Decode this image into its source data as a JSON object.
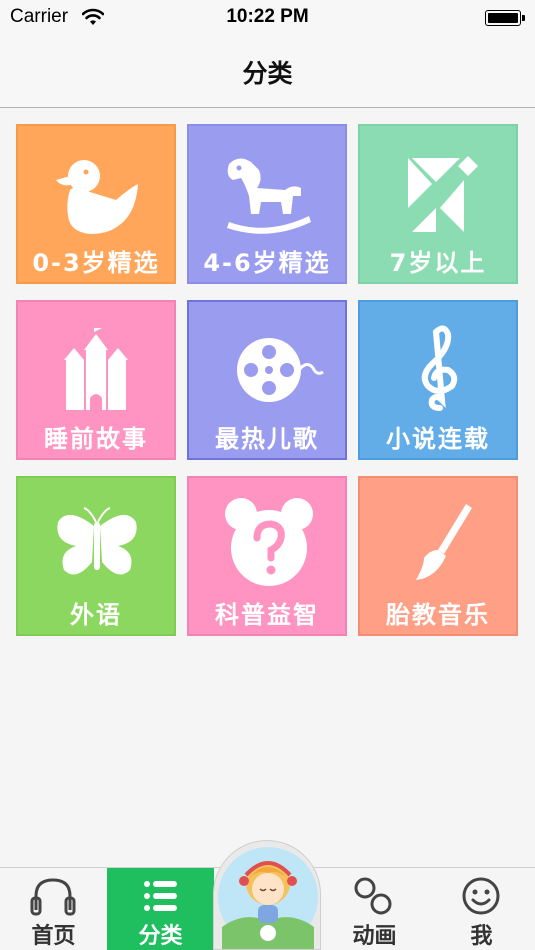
{
  "status_bar": {
    "carrier": "Carrier",
    "time": "10:22 PM"
  },
  "nav": {
    "title": "分类"
  },
  "categories": [
    {
      "label": "0-3岁精选",
      "icon": "duck-icon",
      "bg": "#ffa65a",
      "border": "#f49a4c"
    },
    {
      "label": "4-6岁精选",
      "icon": "rocking-horse-icon",
      "bg": "#9a9cf0",
      "border": "#8c8ee6"
    },
    {
      "label": "7岁以上",
      "icon": "tangram-icon",
      "bg": "#8cdcb3",
      "border": "#7fd2a8"
    },
    {
      "label": "睡前故事",
      "icon": "castle-icon",
      "bg": "#ff93c1",
      "border": "#f283b5"
    },
    {
      "label": "最热儿歌",
      "icon": "film-reel-icon",
      "bg": "#9a9cf0",
      "border": "#6f72d6"
    },
    {
      "label": "小说连载",
      "icon": "treble-clef-icon",
      "bg": "#62ade8",
      "border": "#4d9cdf"
    },
    {
      "label": "外语",
      "icon": "butterfly-icon",
      "bg": "#8cd760",
      "border": "#7fcc52"
    },
    {
      "label": "科普益智",
      "icon": "question-bear-icon",
      "bg": "#ff93c1",
      "border": "#f283b5"
    },
    {
      "label": "胎教音乐",
      "icon": "paintbrush-icon",
      "bg": "#ff9f85",
      "border": "#f58d71"
    }
  ],
  "tabs": [
    {
      "label": "首页",
      "icon": "headphones-icon",
      "active": false
    },
    {
      "label": "分类",
      "icon": "list-icon",
      "active": true
    },
    {
      "label": "",
      "icon": "avatar-icon",
      "active": false
    },
    {
      "label": "动画",
      "icon": "animation-icon",
      "active": false
    },
    {
      "label": "我",
      "icon": "smiley-icon",
      "active": false
    }
  ]
}
